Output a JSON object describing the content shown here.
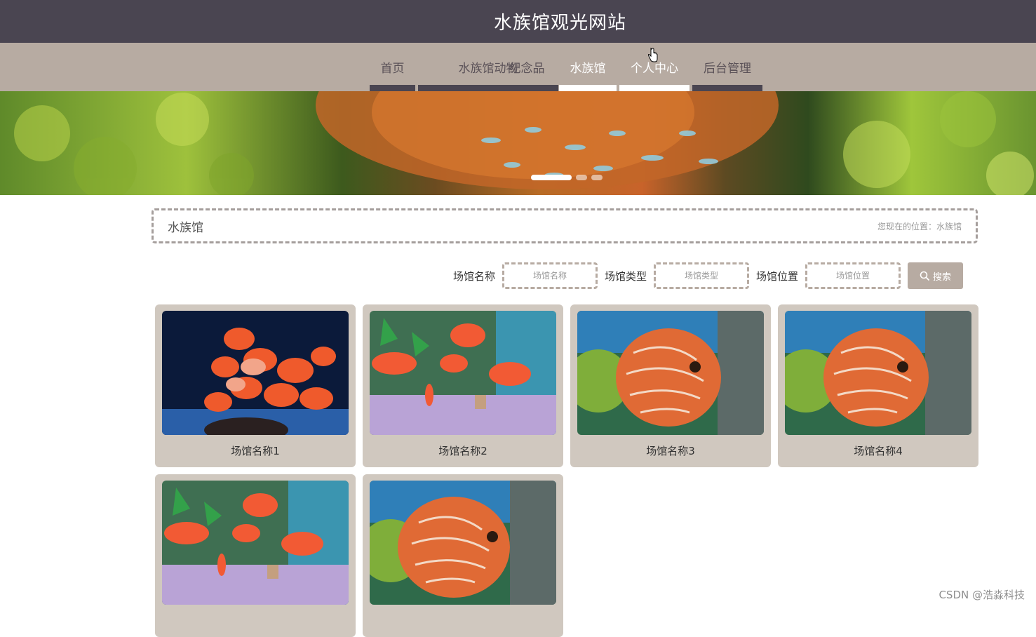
{
  "header": {
    "title": "水族馆观光网站"
  },
  "nav": {
    "items": [
      {
        "label": "首页"
      },
      {
        "label": "水族馆动物"
      },
      {
        "label": "纪念品"
      },
      {
        "label": "水族馆"
      },
      {
        "label": "个人中心"
      },
      {
        "label": "后台管理"
      }
    ],
    "active_index": 3
  },
  "section": {
    "title": "水族馆",
    "location": "您现在的位置：水族馆"
  },
  "search": {
    "name_label": "场馆名称",
    "name_placeholder": "场馆名称",
    "type_label": "场馆类型",
    "type_placeholder": "场馆类型",
    "position_label": "场馆位置",
    "position_placeholder": "场馆位置",
    "button_label": "搜索"
  },
  "cards": [
    {
      "name": "场馆名称1"
    },
    {
      "name": "场馆名称2"
    },
    {
      "name": "场馆名称3"
    },
    {
      "name": "场馆名称4"
    },
    {
      "name": ""
    },
    {
      "name": ""
    }
  ],
  "watermark": "CSDN @浩淼科技",
  "colors": {
    "header_bg": "#4a4551",
    "nav_bg": "#b7aba2",
    "card_bg": "#d0c8bf"
  }
}
